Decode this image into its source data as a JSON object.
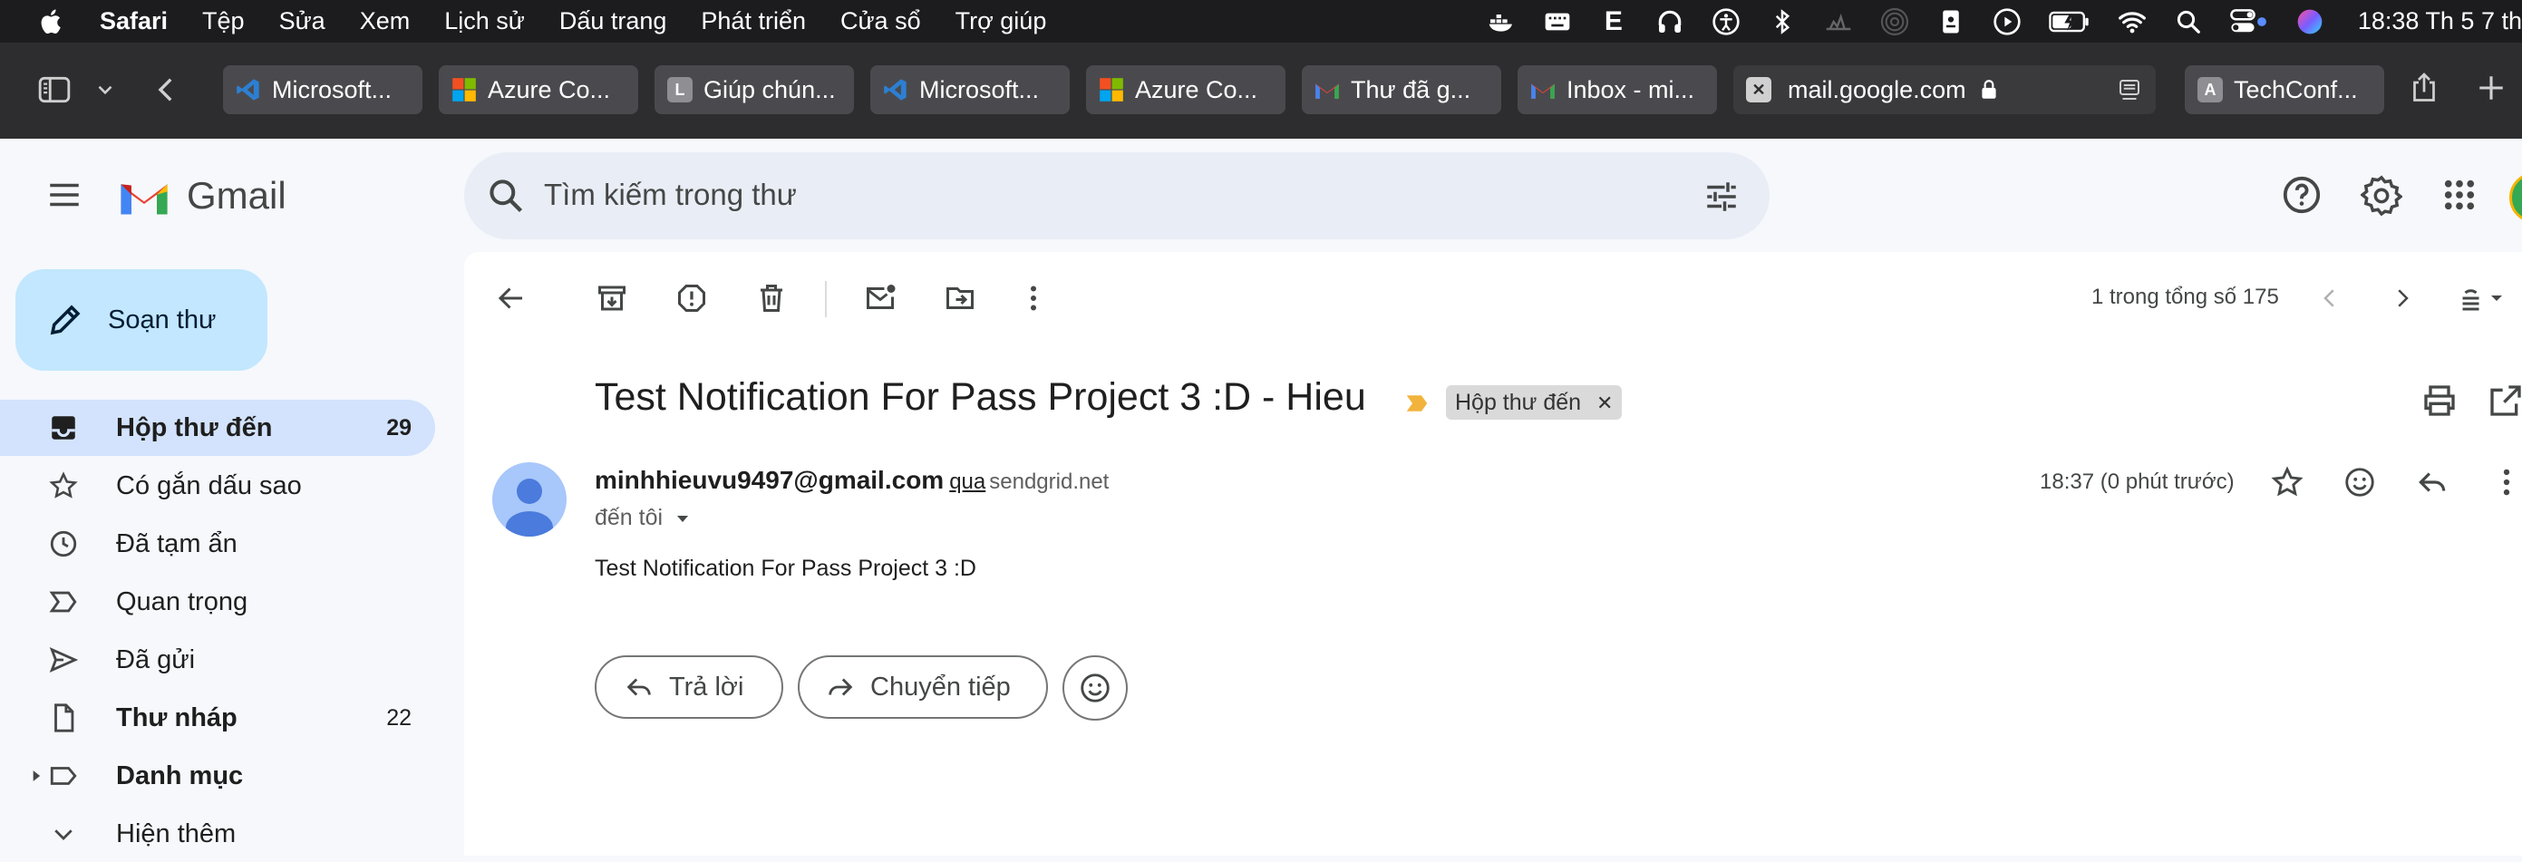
{
  "menubar": {
    "app": "Safari",
    "items": [
      "Tệp",
      "Sửa",
      "Xem",
      "Lịch sử",
      "Dấu trang",
      "Phát triển",
      "Cửa sổ",
      "Trợ giúp"
    ],
    "status_letter": "E",
    "clock": "18:38 Th 5 7 th"
  },
  "tabs": [
    {
      "title": "Microsoft...",
      "fav": "vscode",
      "color": "#2d7fd2"
    },
    {
      "title": "Azure Co...",
      "fav": "ms",
      "color": ""
    },
    {
      "title": "Giúp chún...",
      "fav": "L",
      "color": "#6e6e73"
    },
    {
      "title": "Microsoft...",
      "fav": "vscode",
      "color": "#2d7fd2"
    },
    {
      "title": "Azure Co...",
      "fav": "ms",
      "color": ""
    },
    {
      "title": "Thư đã g...",
      "fav": "gmail",
      "color": ""
    },
    {
      "title": "Inbox - mi...",
      "fav": "gmail",
      "color": ""
    },
    {
      "title": "mail.google.com",
      "fav": "close",
      "color": ""
    },
    {
      "title": "TechConf...",
      "fav": "A",
      "color": "#6e6e73"
    }
  ],
  "gmail": {
    "brand": "Gmail",
    "search_placeholder": "Tìm kiếm trong thư",
    "compose": "Soạn thư",
    "nav": [
      {
        "label": "Hộp thư đến",
        "count": "29",
        "icon": "inbox-icon"
      },
      {
        "label": "Có gắn dấu sao",
        "count": "",
        "icon": "star-icon"
      },
      {
        "label": "Đã tạm ẩn",
        "count": "",
        "icon": "clock-icon"
      },
      {
        "label": "Quan trọng",
        "count": "",
        "icon": "important-icon"
      },
      {
        "label": "Đã gửi",
        "count": "",
        "icon": "send-icon"
      },
      {
        "label": "Thư nháp",
        "count": "22",
        "icon": "draft-icon"
      },
      {
        "label": "Danh mục",
        "count": "",
        "icon": "label-icon"
      },
      {
        "label": "Hiện thêm",
        "count": "",
        "icon": "chevron-down-icon"
      }
    ],
    "pagination": "1 trong tổng số 175",
    "message": {
      "subject": "Test Notification For Pass Project 3 :D - Hieu",
      "label": "Hộp thư đến",
      "sender": "minhhieuvu9497@gmail.com",
      "via": "qua",
      "via_domain": "sendgrid.net",
      "to": "đến tôi",
      "time": "18:37 (0 phút trước)",
      "body": "Test Notification For Pass Project 3 :D"
    },
    "reply": "Trả lời",
    "forward": "Chuyển tiếp"
  },
  "colors": {
    "menubar_bg": "#1c1c1e",
    "toolbar_bg": "#2d2d2f",
    "compose_bg": "#c2e7ff",
    "active_nav_bg": "#d3e3fd",
    "important_marker": "#f2b33d"
  }
}
